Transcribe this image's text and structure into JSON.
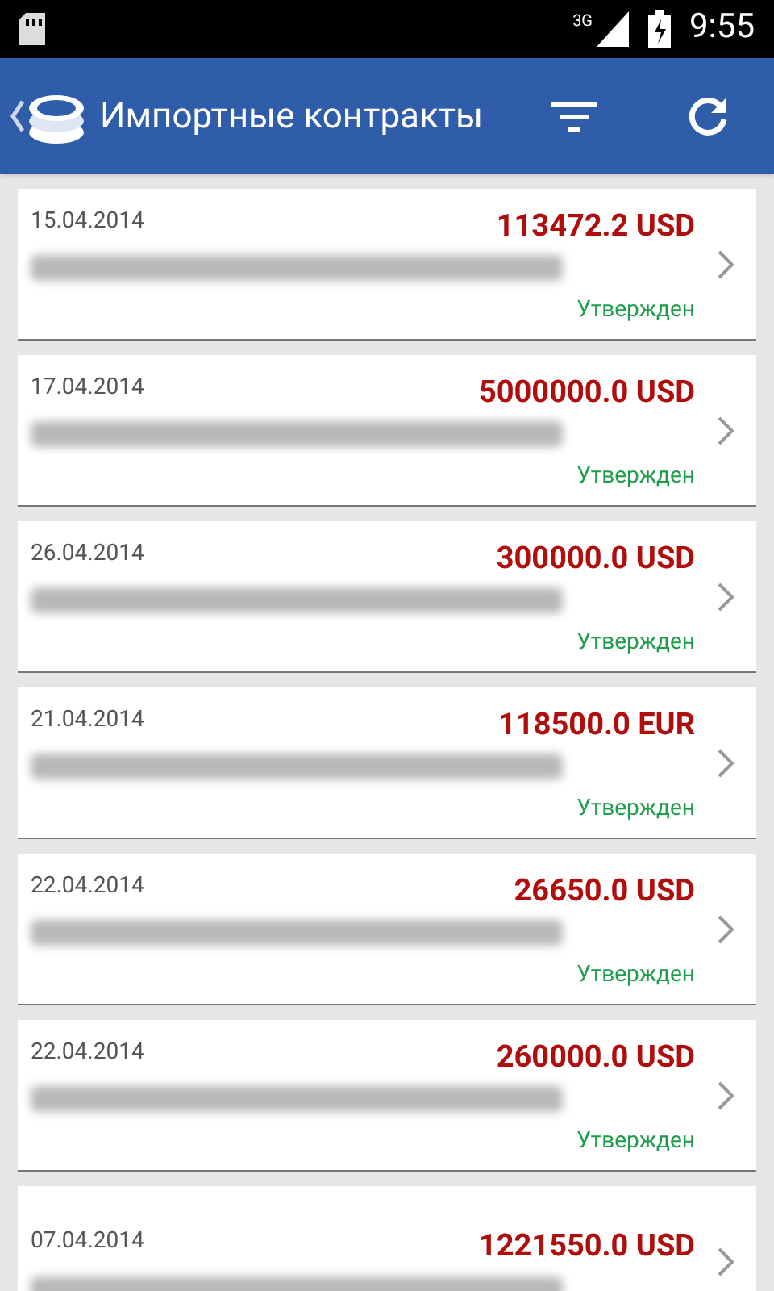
{
  "status_bar": {
    "network": "3G",
    "time": "9:55"
  },
  "header": {
    "title": "Импортные контракты"
  },
  "contracts": [
    {
      "date": "15.04.2014",
      "amount": "113472.2 USD",
      "status": "Утвержден"
    },
    {
      "date": "17.04.2014",
      "amount": "5000000.0 USD",
      "status": "Утвержден"
    },
    {
      "date": "26.04.2014",
      "amount": "300000.0 USD",
      "status": "Утвержден"
    },
    {
      "date": "21.04.2014",
      "amount": "118500.0 EUR",
      "status": "Утвержден"
    },
    {
      "date": "22.04.2014",
      "amount": "26650.0 USD",
      "status": "Утвержден"
    },
    {
      "date": "22.04.2014",
      "amount": "260000.0 USD",
      "status": "Утвержден"
    },
    {
      "date": "07.04.2014",
      "amount": "1221550.0 USD"
    }
  ]
}
